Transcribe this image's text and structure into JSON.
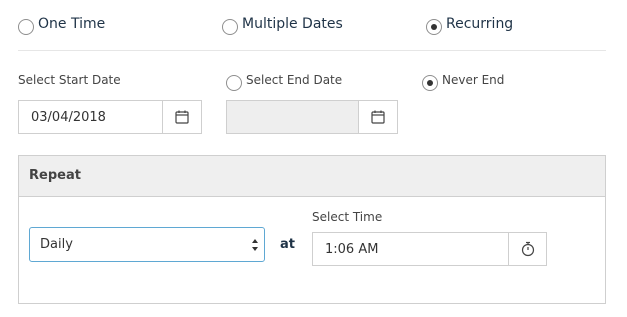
{
  "schedule_type": {
    "options": [
      {
        "label": "One Time",
        "selected": false
      },
      {
        "label": "Multiple Dates",
        "selected": false
      },
      {
        "label": "Recurring",
        "selected": true
      }
    ]
  },
  "dates": {
    "start_label": "Select Start Date",
    "start_value": "03/04/2018",
    "end_label": "Select End Date",
    "end_value": "",
    "end_selected": false,
    "never_end_label": "Never End",
    "never_end_selected": true
  },
  "repeat": {
    "title": "Repeat",
    "frequency": "Daily",
    "at_label": "at",
    "time_label": "Select Time",
    "time_value": "1:06 AM"
  },
  "colors": {
    "text_dark": "#1f3347",
    "select_focus": "#5fa8d3",
    "panel_header": "#efefef",
    "disabled_bg": "#eeeeee"
  },
  "icons": [
    "radio",
    "calendar-icon",
    "timer-icon",
    "select-arrows-icon"
  ]
}
